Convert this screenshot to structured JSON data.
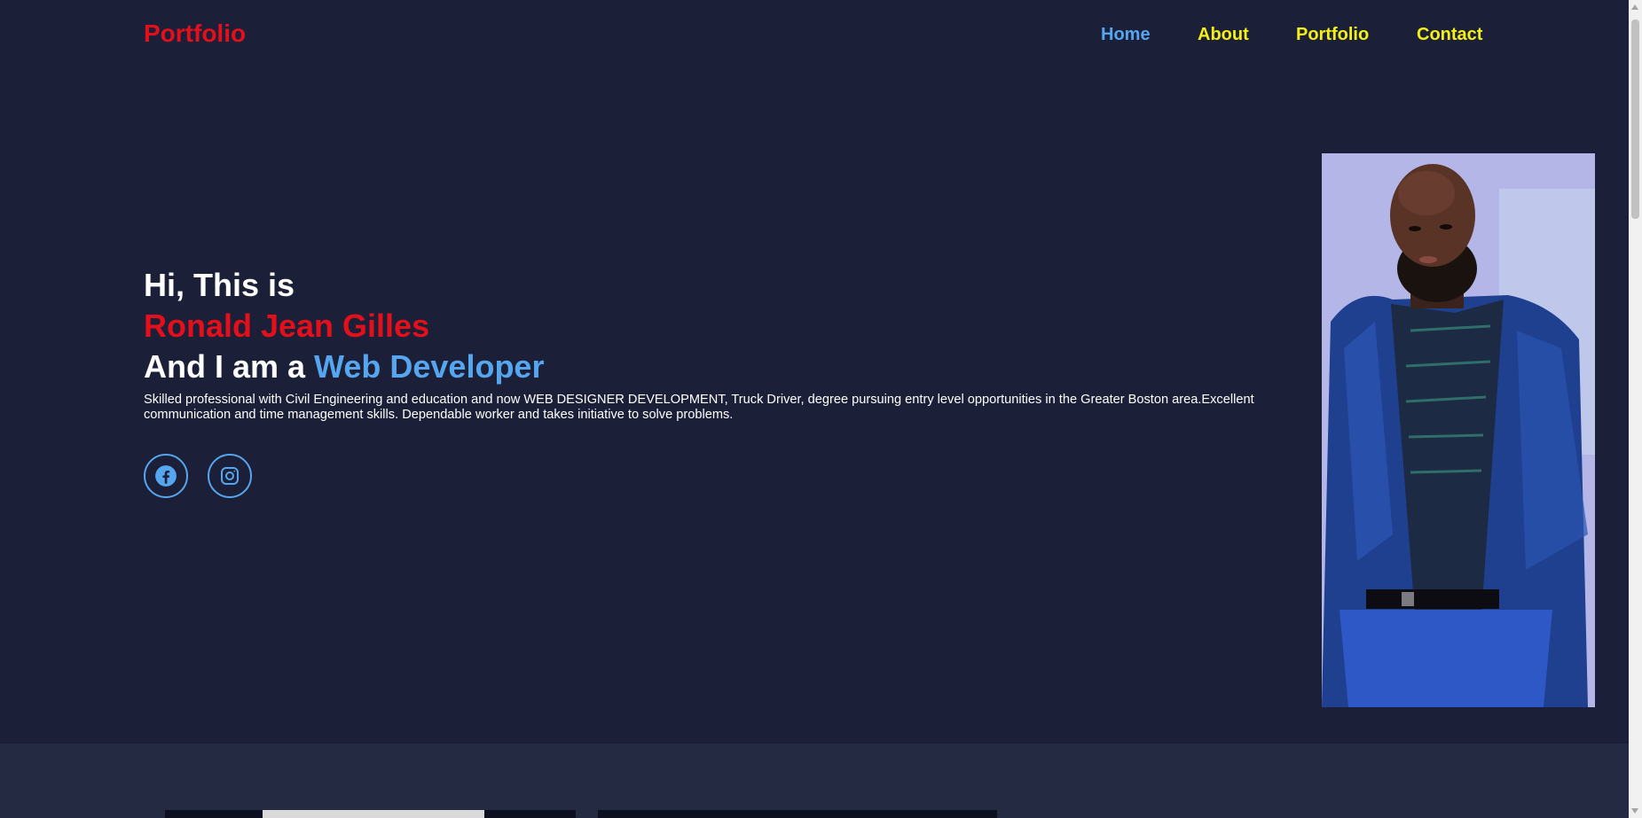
{
  "header": {
    "logo": "Portfolio",
    "nav": [
      {
        "label": "Home"
      },
      {
        "label": "About"
      },
      {
        "label": "Portfolio"
      },
      {
        "label": "Contact"
      }
    ]
  },
  "hero": {
    "greeting": "Hi, This is",
    "name": "Ronald Jean Gilles",
    "role_prefix": "And I am a ",
    "role": "Web Developer",
    "description": "Skilled professional with Civil Engineering and education and now WEB DESIGNER DEVELOPMENT, Truck Driver, degree pursuing entry level opportunities in the Greater Boston area.Excellent communication and time management skills. Dependable worker and takes initiative to solve problems.",
    "social": [
      {
        "icon": "facebook-icon"
      },
      {
        "icon": "instagram-icon"
      }
    ]
  },
  "colors": {
    "background": "#1b1f38",
    "accent_red": "#e3101c",
    "accent_blue": "#55a6ee",
    "nav_yellow": "#f3ef18",
    "section2_bg": "#242a42"
  }
}
